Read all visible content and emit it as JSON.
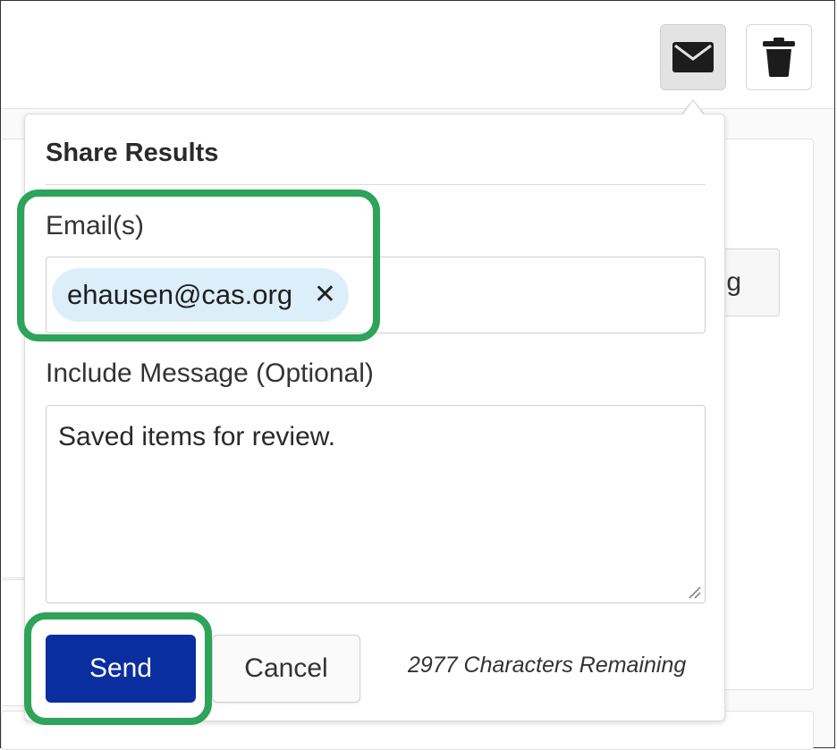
{
  "share_popover": {
    "title": "Share Results",
    "email_label": "Email(s)",
    "email_chips": [
      {
        "value": "ehausen@cas.org",
        "remove_symbol": "✕"
      }
    ],
    "message_label": "Include Message (Optional)",
    "message_value": "Saved items for review.",
    "send_label": "Send",
    "cancel_label": "Cancel",
    "characters_remaining": "2977 Characters Remaining"
  },
  "toolbar": {
    "buttons": [
      {
        "icon": "envelope-icon",
        "active": true
      },
      {
        "icon": "trash-icon",
        "active": false
      }
    ]
  },
  "background": {
    "partial_button_text": "g"
  },
  "colors": {
    "primary_button": "#0a2ea0",
    "chip_background": "#dceefa",
    "highlight": "#2ea35a"
  }
}
